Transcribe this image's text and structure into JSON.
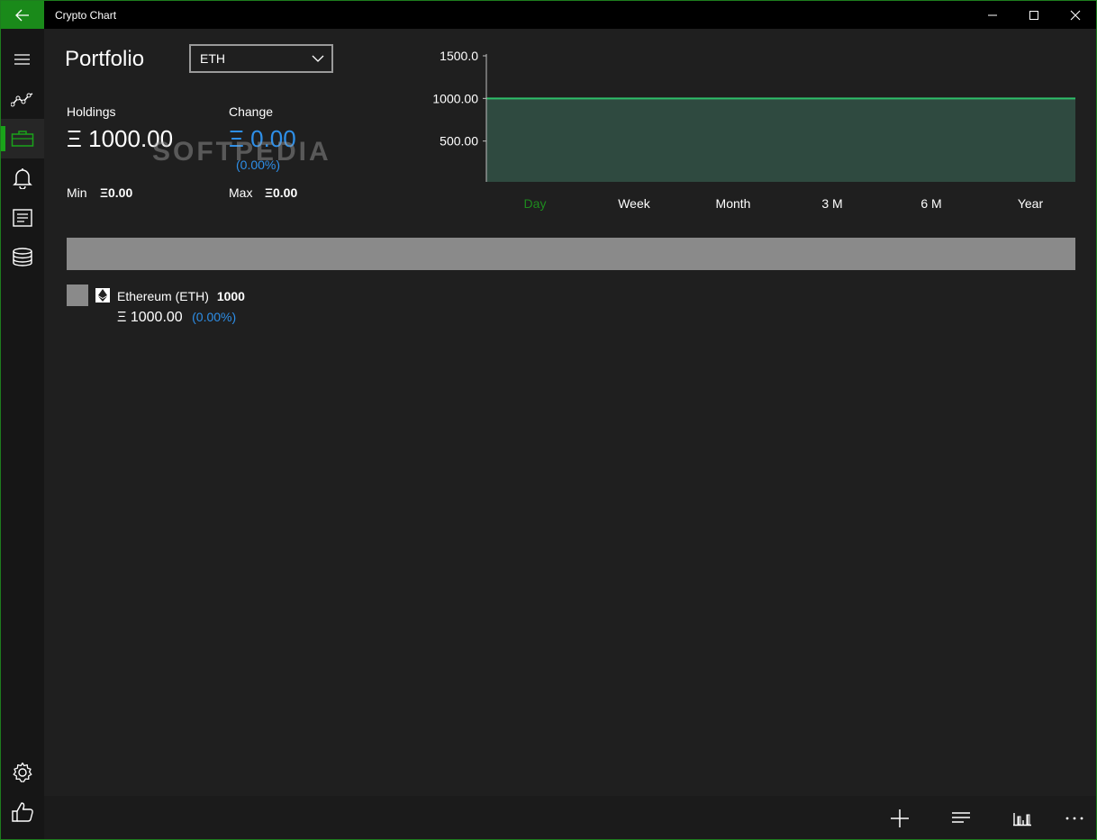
{
  "app": {
    "title": "Crypto Chart"
  },
  "nav": {
    "items": [
      {
        "icon": "hamburger-menu-icon"
      },
      {
        "icon": "chart-line-icon"
      },
      {
        "icon": "briefcase-icon",
        "active": true
      },
      {
        "icon": "bell-icon"
      },
      {
        "icon": "news-icon"
      },
      {
        "icon": "coins-stack-icon"
      },
      {
        "icon": "gear-icon"
      },
      {
        "icon": "thumbs-up-icon"
      }
    ],
    "accent": "#1aa31a"
  },
  "portfolio": {
    "title": "Portfolio",
    "coin_selected": "ETH",
    "holdings_label": "Holdings",
    "holdings_value": "Ξ 1000.00",
    "change_label": "Change",
    "change_value": "Ξ 0.00",
    "change_percent": "(0.00%)",
    "min_label": "Min",
    "min_value": "Ξ0.00",
    "max_label": "Max",
    "max_value": "Ξ0.00"
  },
  "timeframes": [
    "Day",
    "Week",
    "Month",
    "3 M",
    "6 M",
    "Year"
  ],
  "active_timeframe": "Day",
  "holdings_list": [
    {
      "name": "Ethereum (ETH)",
      "amount": "1000",
      "value": "Ξ 1000.00",
      "percent": "(0.00%)"
    }
  ],
  "watermark": "SOFTPEDIA",
  "colors": {
    "line": "#2fbf6a",
    "area": "#2f4a40",
    "blue": "#2e8fe8",
    "green": "#1aa31a"
  },
  "chart_data": {
    "type": "area",
    "x": [
      0,
      1
    ],
    "values": [
      1000,
      1000
    ],
    "ylim": [
      0,
      1500
    ],
    "yticks": [
      "1500.0",
      "1000.00",
      "500.00"
    ],
    "ytick_values": [
      1500,
      1000,
      500
    ],
    "grid": false
  }
}
